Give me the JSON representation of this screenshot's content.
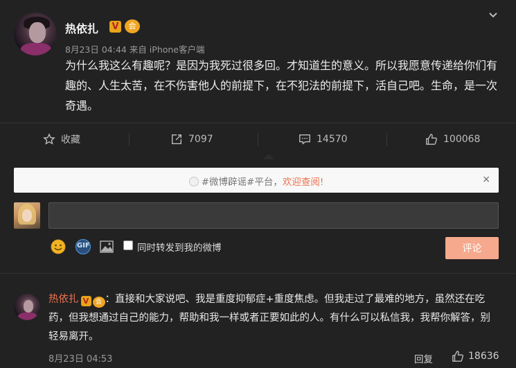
{
  "post": {
    "username": "热依扎",
    "verified_badge": "V",
    "vip_badge": "会",
    "meta": "8月23日 04:44 来自 iPhone客户端",
    "text": "为什么我这么有趣呢？是因为我死过很多回。才知道生的意义。所以我愿意传递给你们有趣的、人生太苦，在不伤害他人的前提下，在不犯法的前提下，活自己吧。生命，是一次奇遇。",
    "more_icon": "chevron-down-icon"
  },
  "actions": {
    "favorite_label": "收藏",
    "repost_count": "7097",
    "comment_count": "14570",
    "like_count": "100068"
  },
  "notice": {
    "tag_text": "#微博辟谣#平台，",
    "highlight_text": "欢迎查阅!",
    "close": "×"
  },
  "composer": {
    "input_value": "",
    "emoji_icon": "emoji-icon",
    "gif_label": "GIF",
    "image_icon": "image-icon",
    "checkbox_label": "同时转发到我的微博",
    "submit_label": "评论"
  },
  "comment": {
    "username": "热依扎",
    "verified_badge": "V",
    "vip_badge": "会",
    "text": "：直接和大家说吧、我是重度抑郁症+重度焦虑。但我走过了最难的地方，虽然还在吃药，但我想通过自己的能力，帮助和我一样或者正要如此的人。有什么可以私信我，我帮你解答，别轻易离开。",
    "time": "8月23日 04:53",
    "reply_label": "回复",
    "like_count": "18636"
  },
  "colors": {
    "background": "#222222",
    "accent": "#eb7350",
    "submit_disabled": "#f6a98c",
    "badge_gold": "#e8a41a"
  }
}
